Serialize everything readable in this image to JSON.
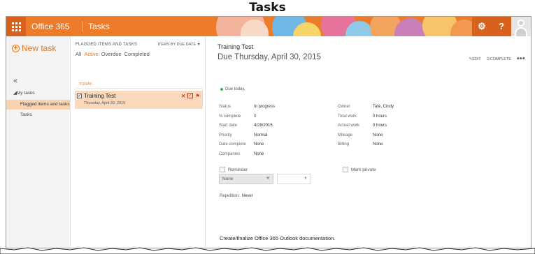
{
  "document_title": "Tasks",
  "topbar": {
    "brand": "Office 365",
    "app_name": "Tasks",
    "settings_icon": "gear-icon",
    "help_label": "?",
    "avatar_icon": "person-icon",
    "accent_color": "#ec7b2a"
  },
  "nav": {
    "new_task_label": "New task",
    "collapse_label": "«",
    "my_tasks_label": "My tasks",
    "items": [
      {
        "label": "Flagged items and tasks",
        "selected": true
      },
      {
        "label": "Tasks",
        "selected": false
      }
    ]
  },
  "list": {
    "header": "FLAGGED ITEMS AND TASKS",
    "sort_label": "ITEMS BY DUE DATE",
    "filters": [
      {
        "label": "All",
        "active": false
      },
      {
        "label": "Active",
        "active": true
      },
      {
        "label": "Overdue",
        "active": false
      },
      {
        "label": "Completed",
        "active": false
      }
    ],
    "group_label": "TODAY",
    "tasks": [
      {
        "title": "Training Test",
        "date": "Thursday, April 30, 2015"
      }
    ]
  },
  "detail": {
    "title": "Training Test",
    "due": "Due Thursday, April 30, 2015",
    "edit_label": "EDIT",
    "complete_label": "COMPLETE",
    "more_label": "•••",
    "status_note": "Due today.",
    "left_fields": [
      {
        "label": "Status",
        "value": "In progress"
      },
      {
        "label": "% complete",
        "value": "0"
      },
      {
        "label": "Start date",
        "value": "4/28/2015"
      },
      {
        "label": "Priority",
        "value": "Normal"
      },
      {
        "label": "Date complete",
        "value": "None"
      },
      {
        "label": "Companies",
        "value": "None"
      }
    ],
    "right_fields": [
      {
        "label": "Owner",
        "value": "Tate, Cindy"
      },
      {
        "label": "Total work",
        "value": "0 hours"
      },
      {
        "label": "Actual work",
        "value": "0 hours"
      },
      {
        "label": "Mileage",
        "value": "None"
      },
      {
        "label": "Billing",
        "value": "None"
      }
    ],
    "reminder_label": "Reminder",
    "reminder_select": "None",
    "mark_private_label": "Mark private",
    "repetition_label": "Repetition:",
    "repetition_value": "Never",
    "notes": "Create/finalize Office 365 Outlook documentation."
  }
}
